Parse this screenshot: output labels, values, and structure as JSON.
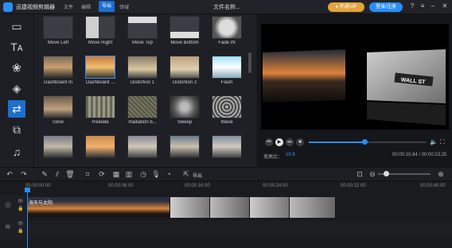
{
  "app": {
    "title": "迅捷视频剪辑器"
  },
  "menu": {
    "file": "文件",
    "edit": "编辑",
    "export": "导出",
    "extra": "领域"
  },
  "project": {
    "filename": "文件名称..."
  },
  "account": {
    "vip_label": "开通VIP",
    "login_label": "登录/注册"
  },
  "window": {
    "help": "?",
    "menu": "≡",
    "minimize": "–",
    "maximize": "□",
    "close": "✕"
  },
  "sidebar": {
    "items": [
      "media",
      "text",
      "filters",
      "overlays",
      "transitions",
      "elements",
      "music"
    ],
    "active": "transitions"
  },
  "transitions": [
    {
      "label": "Move Left"
    },
    {
      "label": "Move Right"
    },
    {
      "label": "Move Top"
    },
    {
      "label": "Move Bottom"
    },
    {
      "label": "Fade IN"
    },
    {
      "label": "Dashboard In"
    },
    {
      "label": "Dashboard ..."
    },
    {
      "label": "Distortion 1"
    },
    {
      "label": "Distortion 2"
    },
    {
      "label": "Flash"
    },
    {
      "label": "Glow"
    },
    {
      "label": "Pixelate"
    },
    {
      "label": "Radiation b..."
    },
    {
      "label": "Sweep"
    },
    {
      "label": "Wave"
    },
    {
      "label": ""
    },
    {
      "label": ""
    },
    {
      "label": ""
    },
    {
      "label": ""
    },
    {
      "label": ""
    }
  ],
  "preview": {
    "aspect_label": "宽高比：",
    "aspect_value": "16:9",
    "timecode": "00:00:10.84 / 00:00:23.25",
    "progress": 0.47,
    "sign_text": "WALL ST"
  },
  "toolbar": {
    "export_label": "导出",
    "zoom": 0.15
  },
  "timeline": {
    "ticks": [
      "00:00:00:00",
      "00:00:08:00",
      "00:00:16:00",
      "00:00:24:00",
      "00:00:32:00",
      "00:00:40:00"
    ],
    "clip_label": "海天与太阳"
  },
  "colors": {
    "accent": "#2a8ef5",
    "vip": "#e2a33d",
    "export_tab": "#1d6fd0"
  }
}
